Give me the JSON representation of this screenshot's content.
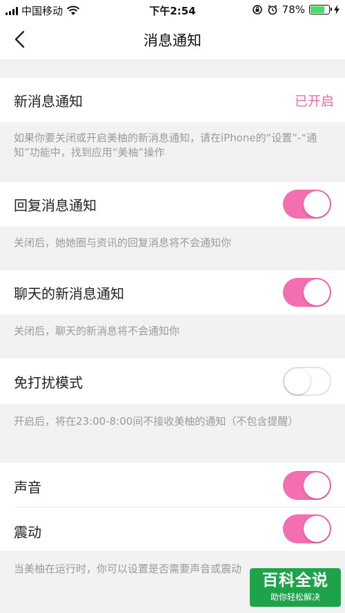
{
  "status_bar": {
    "carrier": "中国移动",
    "time": "下午2:54",
    "battery_percent": "78%",
    "battery_level": 0.78,
    "icons": [
      "signal-icon",
      "wifi-icon",
      "rotation-lock-icon",
      "alarm-icon",
      "battery-icon",
      "charging-icon"
    ]
  },
  "nav": {
    "title": "消息通知",
    "back_icon": "chevron-left-icon"
  },
  "settings": {
    "new_message": {
      "label": "新消息通知",
      "value": "已开启"
    },
    "new_message_note": "如果你要关闭或开启美柚的新消息通知，请在iPhone的“设置”-“通知”功能中，找到应用“美柚”操作",
    "reply_notify": {
      "label": "回复消息通知",
      "on": true
    },
    "reply_note": "关闭后，她她圈与资讯的回复消息将不会通知你",
    "chat_notify": {
      "label": "聊天的新消息通知",
      "on": true
    },
    "chat_note": "关闭后，聊天的新消息将不会通知你",
    "dnd_mode": {
      "label": "免打扰模式",
      "on": false
    },
    "dnd_note": "开启后，将在23:00-8:00间不接收美柚的通知（不包含提醒）",
    "sound": {
      "label": "声音",
      "on": true
    },
    "vibrate": {
      "label": "震动",
      "on": true
    },
    "sound_note": "当美柚在运行时，你可以设置是否需要声音或震动"
  },
  "colors": {
    "accent_pink": "#f36fb2",
    "value_pink": "#e76bb3",
    "background": "#f2f2f2",
    "watermark_green": "#1fa34a"
  },
  "watermark": {
    "title": "百科全说",
    "subtitle": "助你轻松解决"
  }
}
